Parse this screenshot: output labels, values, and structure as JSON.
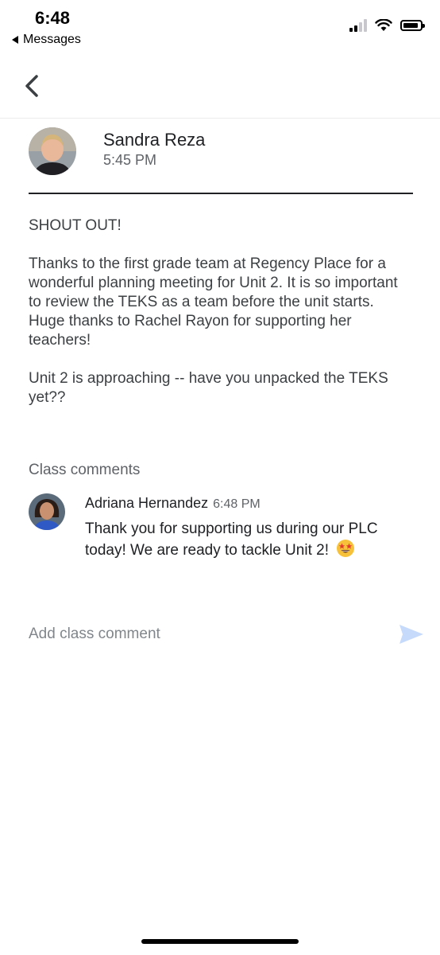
{
  "status_bar": {
    "time": "6:48",
    "back_to_app_label": "Messages"
  },
  "nav": {
    "back_icon": "chevron-left-icon"
  },
  "post": {
    "author_name": "Sandra Reza",
    "time": "5:45 PM",
    "body": "SHOUT OUT!\n\nThanks to the first grade team at Regency Place for a wonderful planning meeting for Unit 2.  It is so important to review the TEKS as a team before the unit starts.  Huge thanks to Rachel Rayon for supporting her teachers!\n\nUnit 2 is approaching -- have you unpacked the TEKS yet??"
  },
  "comments": {
    "heading": "Class comments",
    "items": [
      {
        "author": "Adriana Hernandez",
        "time": "6:48 PM",
        "text": "Thank you for supporting us during our PLC today! We are ready to tackle Unit 2!",
        "emoji": "star-struck-emoji"
      }
    ]
  },
  "composer": {
    "placeholder": "Add class comment",
    "send_icon": "send-icon"
  },
  "colors": {
    "text_primary": "#202124",
    "text_secondary": "#5f6368",
    "send_icon": "#c6dafc"
  }
}
